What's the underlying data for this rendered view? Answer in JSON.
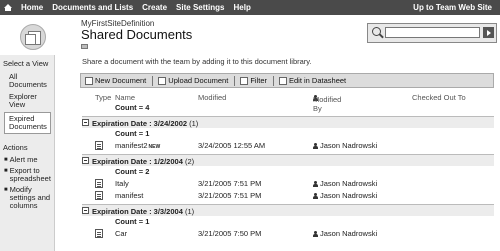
{
  "topbar": {
    "nav": [
      "Home",
      "Documents and Lists",
      "Create",
      "Site Settings",
      "Help"
    ],
    "right_link": "Up to Team Web Site"
  },
  "header": {
    "site_name": "MyFirstSiteDefinition",
    "title": "Shared Documents",
    "search_placeholder": ""
  },
  "sidebar": {
    "view_heading": "Select a View",
    "views": [
      "All Documents",
      "Explorer View",
      "Expired Documents"
    ],
    "selected_view": "Expired Documents",
    "actions_heading": "Actions",
    "actions": [
      "Alert me",
      "Export to spreadsheet",
      "Modify settings and columns"
    ]
  },
  "content": {
    "description": "Share a document with the team by adding it to this document library.",
    "toolbar": [
      "New Document",
      "Upload Document",
      "Filter",
      "Edit in Datasheet"
    ],
    "columns": [
      "Type",
      "Name",
      "Modified",
      "Modified By",
      "Checked Out To"
    ],
    "total_count": "Count = 4",
    "groups": [
      {
        "label": "Expiration Date : 3/24/2002",
        "num": "(1)",
        "count": "Count = 1",
        "rows": [
          {
            "name": "manifest2",
            "new": "NEW",
            "modified": "3/24/2005 12:55 AM",
            "by": "Jason Nadrowski"
          }
        ]
      },
      {
        "label": "Expiration Date : 1/2/2004",
        "num": "(2)",
        "count": "Count = 2",
        "rows": [
          {
            "name": "Italy",
            "new": "",
            "modified": "3/21/2005 7:51 PM",
            "by": "Jason Nadrowski"
          },
          {
            "name": "manifest",
            "new": "",
            "modified": "3/21/2005 7:51 PM",
            "by": "Jason Nadrowski"
          }
        ]
      },
      {
        "label": "Expiration Date : 3/3/2004",
        "num": "(1)",
        "count": "Count = 1",
        "rows": [
          {
            "name": "Car",
            "new": "",
            "modified": "3/21/2005 7:50 PM",
            "by": "Jason Nadrowski"
          }
        ]
      }
    ]
  },
  "colors": {
    "topbar_bg": "#4a4a4a",
    "sidebar_bg": "#ececec",
    "toolbar_bg": "#dcdcdc"
  }
}
